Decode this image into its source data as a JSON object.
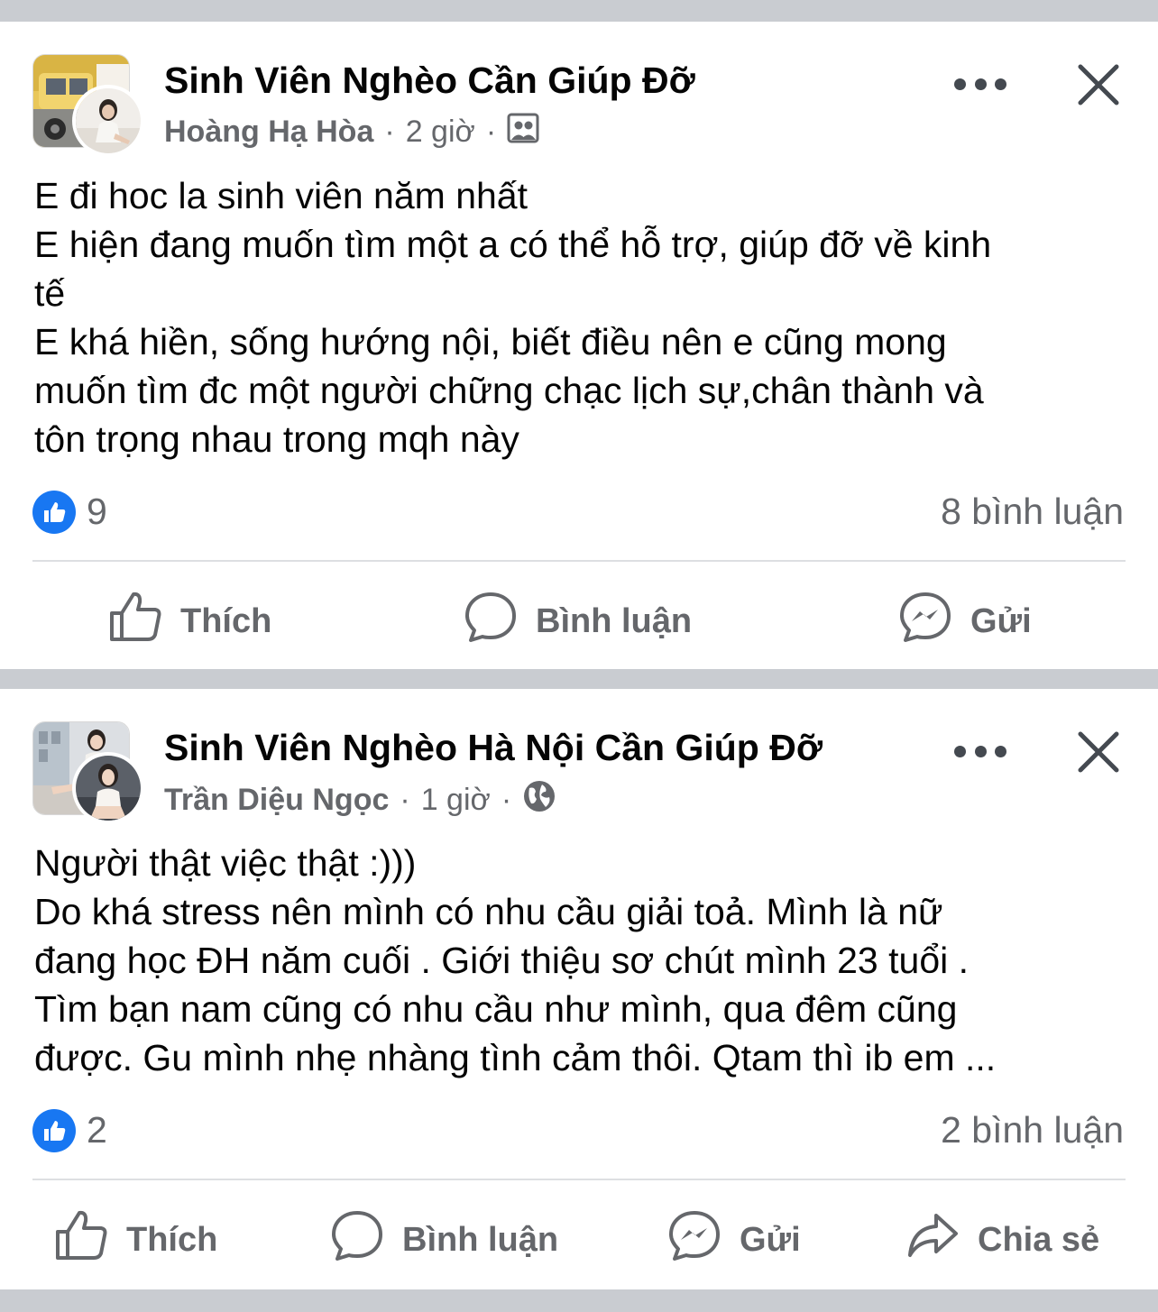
{
  "posts": [
    {
      "group_name": "Sinh Viên Nghèo Cần Giúp Đỡ",
      "author": "Hoàng Hạ Hòa",
      "time": "2 giờ",
      "separator": "·",
      "audience_icon": "group-members-icon",
      "body_lines": [
        "E đi hoc la sinh viên năm nhất",
        "E hiện đang muốn tìm một a có thể hỗ trợ, giúp đỡ về kinh",
        "tế",
        "E khá hiền, sống hướng nội, biết điều nên e cũng mong",
        "muốn tìm đc một người chững chạc lịch sự,chân thành và",
        "tôn trọng nhau trong mqh này"
      ],
      "like_count": "9",
      "comment_count": "8 bình luận",
      "actions": {
        "like": "Thích",
        "comment": "Bình luận",
        "send": "Gửi"
      }
    },
    {
      "group_name": "Sinh Viên Nghèo Hà Nội Cần Giúp Đỡ",
      "author": "Trần Diệu Ngọc",
      "time": "1 giờ",
      "separator": "·",
      "audience_icon": "globe-icon",
      "body_lines": [
        "Người thật việc thật :)))",
        "Do khá stress nên mình có nhu cầu giải toả. Mình là nữ",
        "đang học ĐH năm cuối . Giới thiệu sơ chút mình 23 tuổi .",
        "Tìm bạn nam cũng có nhu cầu như mình, qua đêm cũng",
        "được. Gu mình nhẹ nhàng tình cảm thôi. Qtam thì ib em ..."
      ],
      "like_count": "2",
      "comment_count": "2 bình luận",
      "actions": {
        "like": "Thích",
        "comment": "Bình luận",
        "send": "Gửi",
        "share": "Chia sẻ"
      }
    }
  ],
  "colors": {
    "accent_blue": "#1877f2",
    "secondary_text": "#65676b",
    "separator": "#c9ccd1"
  }
}
